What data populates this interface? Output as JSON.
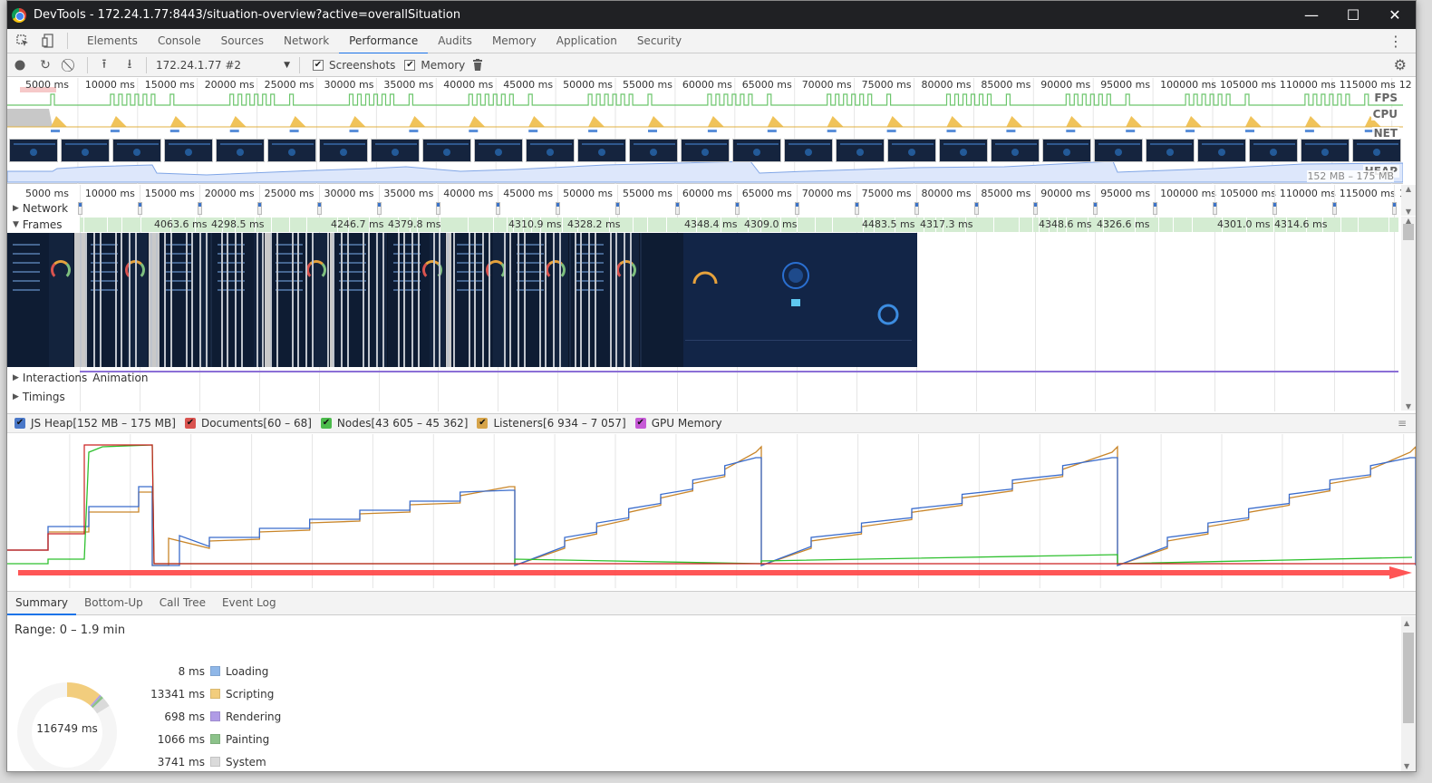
{
  "window": {
    "title": "DevTools - 172.24.1.77:8443/situation-overview?active=overallSituation",
    "controls": {
      "minimize": "—",
      "maximize": "☐",
      "close": "✕"
    }
  },
  "tabs": [
    {
      "label": "Elements",
      "active": false
    },
    {
      "label": "Console",
      "active": false
    },
    {
      "label": "Sources",
      "active": false
    },
    {
      "label": "Network",
      "active": false
    },
    {
      "label": "Performance",
      "active": true
    },
    {
      "label": "Audits",
      "active": false
    },
    {
      "label": "Memory",
      "active": false
    },
    {
      "label": "Application",
      "active": false
    },
    {
      "label": "Security",
      "active": false
    }
  ],
  "toolbar": {
    "profile_select": "172.24.1.77 #2",
    "screenshots_label": "Screenshots",
    "screenshots_checked": true,
    "memory_label": "Memory",
    "memory_checked": true
  },
  "overview": {
    "tick_labels": [
      "5000 ms",
      "10000 ms",
      "15000 ms",
      "20000 ms",
      "25000 ms",
      "30000 ms",
      "35000 ms",
      "40000 ms",
      "45000 ms",
      "50000 ms",
      "55000 ms",
      "60000 ms",
      "65000 ms",
      "70000 ms",
      "75000 ms",
      "80000 ms",
      "85000 ms",
      "90000 ms",
      "95000 ms",
      "100000 ms",
      "105000 ms",
      "110000 ms",
      "115000 ms",
      "12"
    ],
    "track_labels": {
      "fps": "FPS",
      "cpu": "CPU",
      "net": "NET",
      "heap": "HEAP"
    },
    "heap_range": "152 MB – 175 MB"
  },
  "timeline": {
    "tick_labels": [
      "5000 ms",
      "10000 ms",
      "15000 ms",
      "20000 ms",
      "25000 ms",
      "30000 ms",
      "35000 ms",
      "40000 ms",
      "45000 ms",
      "50000 ms",
      "55000 ms",
      "60000 ms",
      "65000 ms",
      "70000 ms",
      "75000 ms",
      "80000 ms",
      "85000 ms",
      "90000 ms",
      "95000 ms",
      "100000 ms",
      "105000 ms",
      "110000 ms",
      "115000 ms",
      "12"
    ],
    "sections": {
      "network": "Network",
      "frames": "Frames",
      "interactions": "Interactions",
      "animation": "Animation",
      "timings": "Timings"
    },
    "frame_durations": [
      "4063.6 ms",
      "4298.5 ms",
      "4246.7 ms",
      "4379.8 ms",
      "4310.9 ms",
      "4328.2 ms",
      "4348.4 ms",
      "4309.0 ms",
      "4483.5 ms",
      "4317.3 ms",
      "4348.6 ms",
      "4326.6 ms",
      "4301.0 ms",
      "4314.6 ms"
    ]
  },
  "memory": {
    "legend": [
      {
        "label": "JS Heap[152 MB – 175 MB]",
        "color": "#4a78c8",
        "checked": true
      },
      {
        "label": "Documents[60 – 68]",
        "color": "#d9534f",
        "checked": true
      },
      {
        "label": "Nodes[43 605 – 45 362]",
        "color": "#4cbb4c",
        "checked": true
      },
      {
        "label": "Listeners[6 934 – 7 057]",
        "color": "#d6a44a",
        "checked": true
      },
      {
        "label": "GPU Memory",
        "color": "#c65ad6",
        "checked": true
      }
    ]
  },
  "bottom_tabs": [
    {
      "label": "Summary",
      "active": true
    },
    {
      "label": "Bottom-Up",
      "active": false
    },
    {
      "label": "Call Tree",
      "active": false
    },
    {
      "label": "Event Log",
      "active": false
    }
  ],
  "summary": {
    "range": "Range: 0 – 1.9 min",
    "total": "116749 ms",
    "total_ms": 116749,
    "categories": [
      {
        "value": "8 ms",
        "ms": 8,
        "name": "Loading",
        "color": "#8fb7e8"
      },
      {
        "value": "13341 ms",
        "ms": 13341,
        "name": "Scripting",
        "color": "#f2cd7d"
      },
      {
        "value": "698 ms",
        "ms": 698,
        "name": "Rendering",
        "color": "#b09be6"
      },
      {
        "value": "1066 ms",
        "ms": 1066,
        "name": "Painting",
        "color": "#8cc28a"
      },
      {
        "value": "3741 ms",
        "ms": 3741,
        "name": "System",
        "color": "#dadada"
      }
    ],
    "idle_color": "#f5f5f5"
  }
}
